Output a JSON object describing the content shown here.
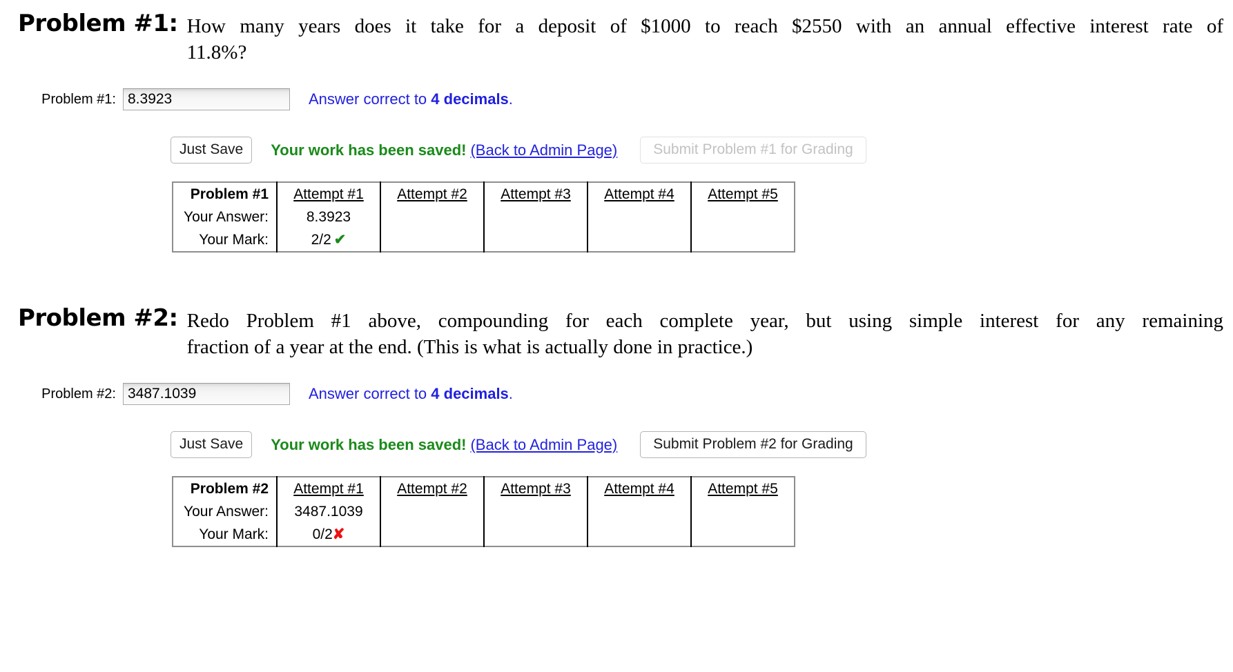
{
  "problems": [
    {
      "heading": "Problem #1:",
      "statement_line_1": "How many years does it take for a deposit of $1000 to reach $2550 with an annual effective interest rate of",
      "statement_line_2": "11.8%?",
      "answer_label": "Problem #1:",
      "answer_value": "8.3923",
      "answer_placeholder": "",
      "hint_prefix": "Answer correct to ",
      "hint_emphasis": "4 decimals",
      "hint_suffix": ".",
      "just_save_label": "Just Save",
      "saved_message": "Your work has been saved!",
      "admin_link_label": "(Back to Admin Page)",
      "submit_label": "Submit Problem #1 for Grading",
      "submit_disabled": true,
      "table": {
        "corner_label": "Problem #1",
        "row_labels": [
          "Your Answer:",
          "Your Mark:"
        ],
        "attempt_headers": [
          "Attempt #1",
          "Attempt #2",
          "Attempt #3",
          "Attempt #4",
          "Attempt #5"
        ],
        "answers": [
          "8.3923",
          "",
          "",
          "",
          ""
        ],
        "marks": [
          "2/2",
          "",
          "",
          "",
          ""
        ],
        "mark_status": [
          "correct",
          "",
          "",
          "",
          ""
        ],
        "correct_glyph": "✔",
        "incorrect_glyph": "✘"
      }
    },
    {
      "heading": "Problem #2:",
      "statement_line_1": "Redo Problem #1 above, compounding for each complete year, but using simple interest for any remaining",
      "statement_line_2": "fraction of a year at the end. (This is what is actually done in practice.)",
      "answer_label": "Problem #2:",
      "answer_value": "3487.1039",
      "answer_placeholder": "",
      "hint_prefix": "Answer correct to ",
      "hint_emphasis": "4 decimals",
      "hint_suffix": ".",
      "just_save_label": "Just Save",
      "saved_message": "Your work has been saved!",
      "admin_link_label": "(Back to Admin Page)",
      "submit_label": "Submit Problem #2 for Grading",
      "submit_disabled": false,
      "table": {
        "corner_label": "Problem #2",
        "row_labels": [
          "Your Answer:",
          "Your Mark:"
        ],
        "attempt_headers": [
          "Attempt #1",
          "Attempt #2",
          "Attempt #3",
          "Attempt #4",
          "Attempt #5"
        ],
        "answers": [
          "3487.1039",
          "",
          "",
          "",
          ""
        ],
        "marks": [
          "0/2",
          "",
          "",
          "",
          ""
        ],
        "mark_status": [
          "incorrect",
          "",
          "",
          "",
          ""
        ],
        "correct_glyph": "✔",
        "incorrect_glyph": "✘"
      }
    }
  ],
  "colors": {
    "link_blue": "#2222dd",
    "hint_blue": "#1f1fe0",
    "success_green": "#1a8a1a",
    "error_red": "#ee1111",
    "table_outer_border": "#8e8e8e"
  }
}
